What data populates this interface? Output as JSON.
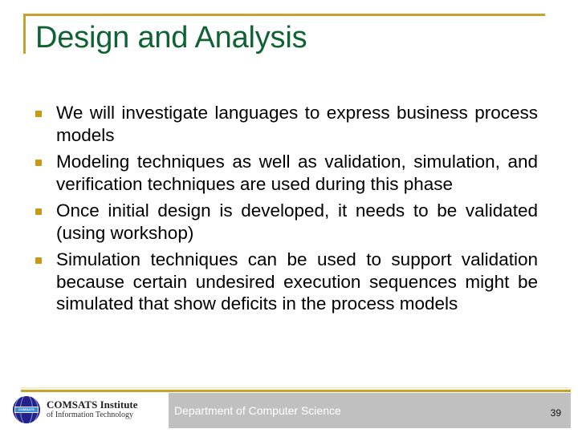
{
  "slide": {
    "title": "Design and Analysis",
    "bullets": [
      "We will investigate languages to express business process models",
      "Modeling techniques as well as validation, simulation, and verification techniques are used during this phase",
      "Once initial design is developed, it needs to be validated (using workshop)",
      "Simulation techniques can be used to support validation because certain undesired execution sequences might be simulated that show deficits in the process models"
    ]
  },
  "footer": {
    "logo": {
      "line1": "COMSATS Institute",
      "line2": "of Information Technology",
      "globe_label": "COMSATS"
    },
    "department": "Department of Computer Science",
    "page_number": "39"
  },
  "colors": {
    "accent_gold": "#c8a22e",
    "title_green": "#0f6333",
    "footer_gray": "#c0c0c0"
  }
}
